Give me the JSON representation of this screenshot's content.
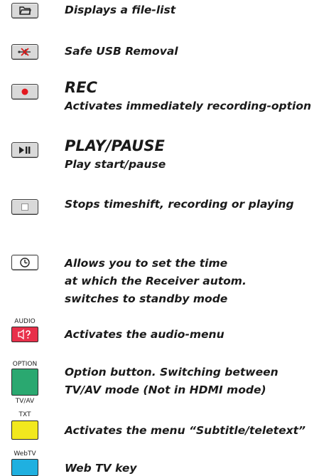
{
  "items": [
    {
      "icon": "folder-icon",
      "text": "Displays a file-list"
    },
    {
      "icon": "usb-remove-icon",
      "text": "Safe USB Removal"
    },
    {
      "icon": "record-icon",
      "title": "REC",
      "text": "Activates immediately recording-option"
    },
    {
      "icon": "play-pause-icon",
      "title": "PLAY/PAUSE",
      "text": "Play start/pause"
    },
    {
      "icon": "stop-icon",
      "text": "Stops timeshift, recording or playing"
    },
    {
      "icon": "clock-icon",
      "lines": [
        "Allows you to set the time",
        "at which the Receiver autom.",
        "switches to standby mode"
      ]
    },
    {
      "label_top": "AUDIO",
      "icon": "speaker-question-icon",
      "color": "#e8304a",
      "text": "Activates the audio-menu"
    },
    {
      "label_top": "OPTION",
      "label_bottom": "TV/AV",
      "color": "#2aa870",
      "lines": [
        "Option button. Switching between",
        "TV/AV mode (Not in HDMI mode)"
      ]
    },
    {
      "label_top": "TXT",
      "color": "#f2e81e",
      "text": "Activates the menu “Subtitle/teletext”"
    },
    {
      "label_top": "WebTV",
      "color": "#1fb0e0",
      "text": "Web TV key"
    }
  ]
}
